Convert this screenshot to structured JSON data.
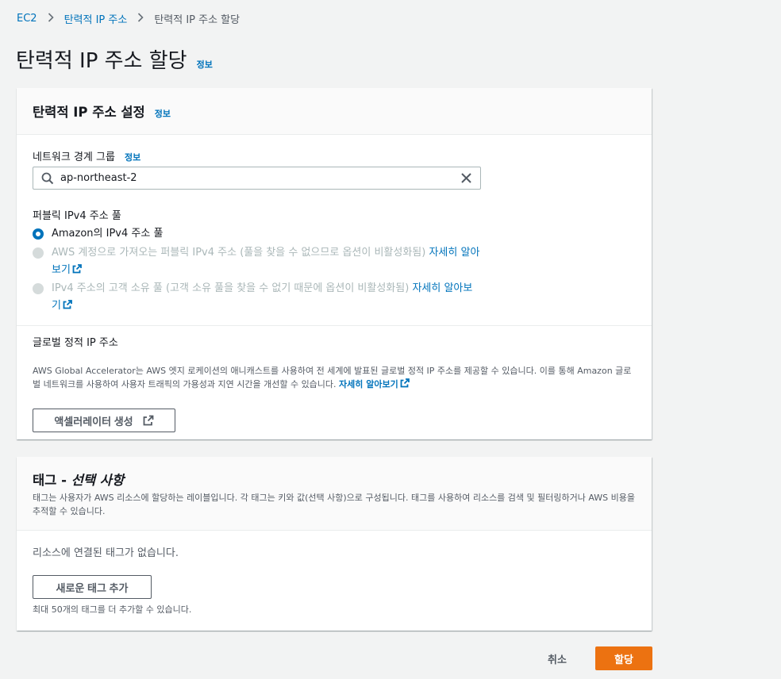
{
  "breadcrumb": {
    "items": [
      "EC2",
      "탄력적 IP 주소",
      "탄력적 IP 주소 할당"
    ]
  },
  "page": {
    "title": "탄력적 IP 주소 할당",
    "info": "정보"
  },
  "settings": {
    "title": "탄력적 IP 주소 설정",
    "info": "정보",
    "network_border_group": {
      "label": "네트워크 경계 그룹",
      "info": "정보",
      "value": "ap-northeast-2"
    },
    "pool": {
      "label": "퍼블릭 IPv4 주소 풀",
      "options": [
        {
          "text": "Amazon의 IPv4 주소 풀",
          "selected": true,
          "disabled": false
        },
        {
          "text": "AWS 계정으로 가져오는 퍼블릭 IPv4 주소 (풀을 찾을 수 없으므로 옵션이 비활성화됨)",
          "link": "자세히 알아보기",
          "selected": false,
          "disabled": true
        },
        {
          "text": "IPv4 주소의 고객 소유 풀 (고객 소유 풀을 찾을 수 없기 때문에 옵션이 비활성화됨)",
          "link": "자세히 알아보기",
          "selected": false,
          "disabled": true
        }
      ]
    },
    "global": {
      "label": "글로벌 정적 IP 주소",
      "description": "AWS Global Accelerator는 AWS 엣지 로케이션의 애니캐스트를 사용하여 전 세계에 발표된 글로벌 정적 IP 주소를 제공할 수 있습니다. 이를 통해 Amazon 글로벌 네트워크를 사용하여 사용자 트래픽의 가용성과 지연 시간을 개선할 수 있습니다.",
      "link": "자세히 알아보기",
      "button": "액셀러레이터 생성"
    }
  },
  "tags": {
    "title_prefix": "태그 - ",
    "title_suffix": "선택 사항",
    "description": "태그는 사용자가 AWS 리소스에 할당하는 레이블입니다. 각 태그는 키와 값(선택 사항)으로 구성됩니다. 태그를 사용하여 리소스를 검색 및 필터링하거나 AWS 비용을 추적할 수 있습니다.",
    "empty": "리소스에 연결된 태그가 없습니다.",
    "add_button": "새로운 태그 추가",
    "limit": "최대 50개의 태그를 더 추가할 수 있습니다."
  },
  "footer": {
    "cancel": "취소",
    "submit": "할당"
  },
  "colors": {
    "link": "#0073bb",
    "primary": "#ec7211",
    "background": "#f2f3f3"
  }
}
